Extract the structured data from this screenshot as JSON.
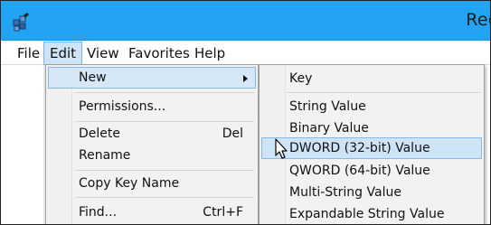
{
  "window": {
    "title": "Reg",
    "title_bar_color": "#23a4f3",
    "icon": "registry-editor-icon"
  },
  "menubar": {
    "items": [
      {
        "label": "File"
      },
      {
        "label": "Edit"
      },
      {
        "label": "View"
      },
      {
        "label": "Favorites"
      },
      {
        "label": "Help"
      }
    ],
    "active": "Edit"
  },
  "edit_menu": {
    "items": [
      {
        "label": "New",
        "has_submenu": true
      },
      {
        "label": "Permissions..."
      },
      {
        "label": "Delete",
        "shortcut": "Del"
      },
      {
        "label": "Rename"
      },
      {
        "label": "Copy Key Name"
      },
      {
        "label": "Find...",
        "shortcut": "Ctrl+F"
      }
    ],
    "highlighted": "New"
  },
  "new_submenu": {
    "items": [
      {
        "label": "Key"
      },
      {
        "label": "String Value"
      },
      {
        "label": "Binary Value"
      },
      {
        "label": "DWORD (32-bit) Value"
      },
      {
        "label": "QWORD (64-bit) Value"
      },
      {
        "label": "Multi-String Value"
      },
      {
        "label": "Expandable String Value"
      }
    ],
    "highlighted": "DWORD (32-bit) Value"
  },
  "colors": {
    "highlight_bg": "#cfe3f7",
    "highlight_border": "#86b9ea",
    "menu_bg": "#f2f2f2"
  }
}
